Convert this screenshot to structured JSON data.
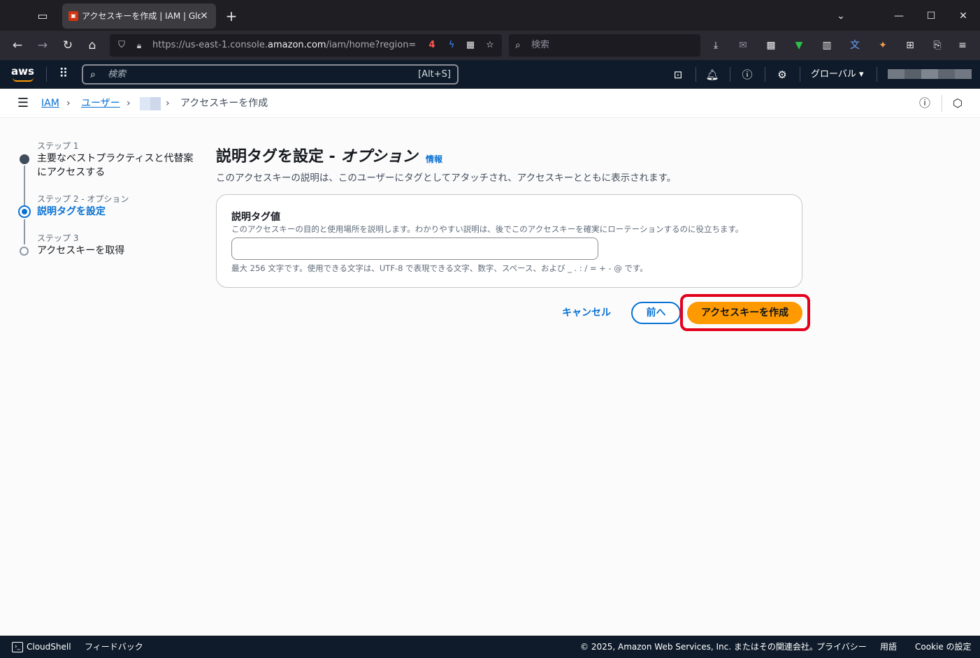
{
  "browser": {
    "tab_title": "アクセスキーを作成 | IAM | Global",
    "favicon_icon": "aws-service-icon",
    "url_prefix": "https://us-east-1.console.",
    "url_domain": "amazon.com",
    "url_suffix": "/iam/home?region=",
    "search_placeholder": "検索"
  },
  "aws_header": {
    "logo_text": "aws",
    "search_placeholder": "検索",
    "search_shortcut": "[Alt+S]",
    "region_label": "グローバル ▾"
  },
  "breadcrumb": {
    "items": [
      "IAM",
      "ユーザー"
    ],
    "current": "アクセスキーを作成"
  },
  "wizard": {
    "steps": [
      {
        "label": "ステップ 1",
        "title": "主要なベストプラクティスと代替案にアクセスする",
        "state": "done"
      },
      {
        "label": "ステップ 2 - オプション",
        "title": "説明タグを設定",
        "state": "active"
      },
      {
        "label": "ステップ 3",
        "title": "アクセスキーを取得",
        "state": "todo"
      }
    ]
  },
  "page": {
    "title_main": "説明タグを設定 - ",
    "title_option": "オプション",
    "info_link": "情報",
    "description": "このアクセスキーの説明は、このユーザーにタグとしてアタッチされ、アクセスキーとともに表示されます。"
  },
  "form": {
    "field_label": "説明タグ値",
    "field_description": "このアクセスキーの目的と使用場所を説明します。わかりやすい説明は、後でこのアクセスキーを確実にローテーションするのに役立ちます。",
    "field_value": "",
    "field_constraint": "最大 256 文字です。使用できる文字は、UTF-8 で表現できる文字、数字、スペース、および _ . : / = + - @ です。"
  },
  "actions": {
    "cancel_label": "キャンセル",
    "previous_label": "前へ",
    "primary_label": "アクセスキーを作成"
  },
  "footer": {
    "cloudshell_label": "CloudShell",
    "feedback_label": "フィードバック",
    "copyright": "© 2025, Amazon Web Services, Inc. またはその関連会社。",
    "privacy": "プライバシー",
    "terms": "用語",
    "cookie": "Cookie の設定"
  },
  "colors": {
    "aws_navy": "#0f1b2a",
    "link_blue": "#0972d3",
    "primary_orange": "#ff9900",
    "highlight_red": "#e3001b"
  }
}
